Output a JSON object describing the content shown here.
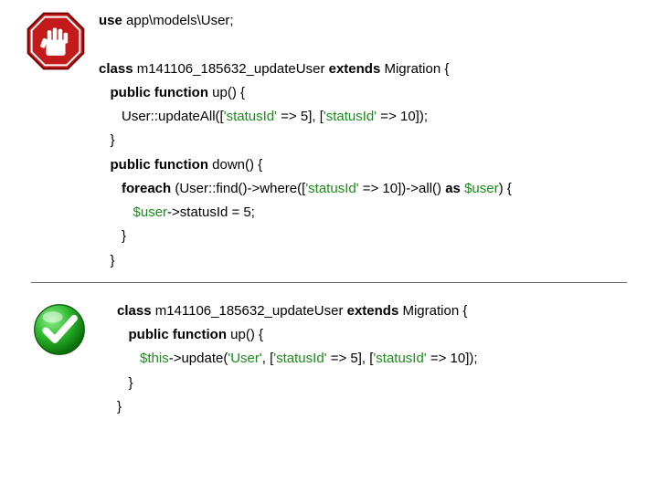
{
  "bad": {
    "icon": "stop-icon",
    "l1a": "use",
    "l1b": " app\\models\\User;",
    "l2a": "class",
    "l2b": " m141106_185632_updateUser ",
    "l2c": "extends",
    "l2d": " Migration {",
    "l3a": "   public function",
    "l3b": " up() {",
    "l4a": "      User::updateAll([",
    "l4b": "'statusId'",
    "l4c": " => 5], [",
    "l4d": "'statusId'",
    "l4e": " => 10]);",
    "l5": "   }",
    "l6a": "   public function",
    "l6b": " down() {",
    "l7a": "      foreach ",
    "l7b": "(User::find()->where([",
    "l7c": "'statusId'",
    "l7d": " => 10])->all() ",
    "l7e": "as ",
    "l7f": "$user",
    "l7g": ") {",
    "l8a": "         ",
    "l8b": "$user",
    "l8c": "->statusId = 5;",
    "l9": "      }",
    "l10": "   }"
  },
  "good": {
    "icon": "check-icon",
    "l1a": "class",
    "l1b": " m141106_185632_updateUser ",
    "l1c": "extends",
    "l1d": " Migration {",
    "l2a": "   public function",
    "l2b": " up() {",
    "l3a": "      ",
    "l3b": "$this",
    "l3c": "->update(",
    "l3d": "'User'",
    "l3e": ", [",
    "l3f": "'statusId'",
    "l3g": " => 5], [",
    "l3h": "'statusId'",
    "l3i": " => 10]);",
    "l4": "   }",
    "l5": "}"
  }
}
